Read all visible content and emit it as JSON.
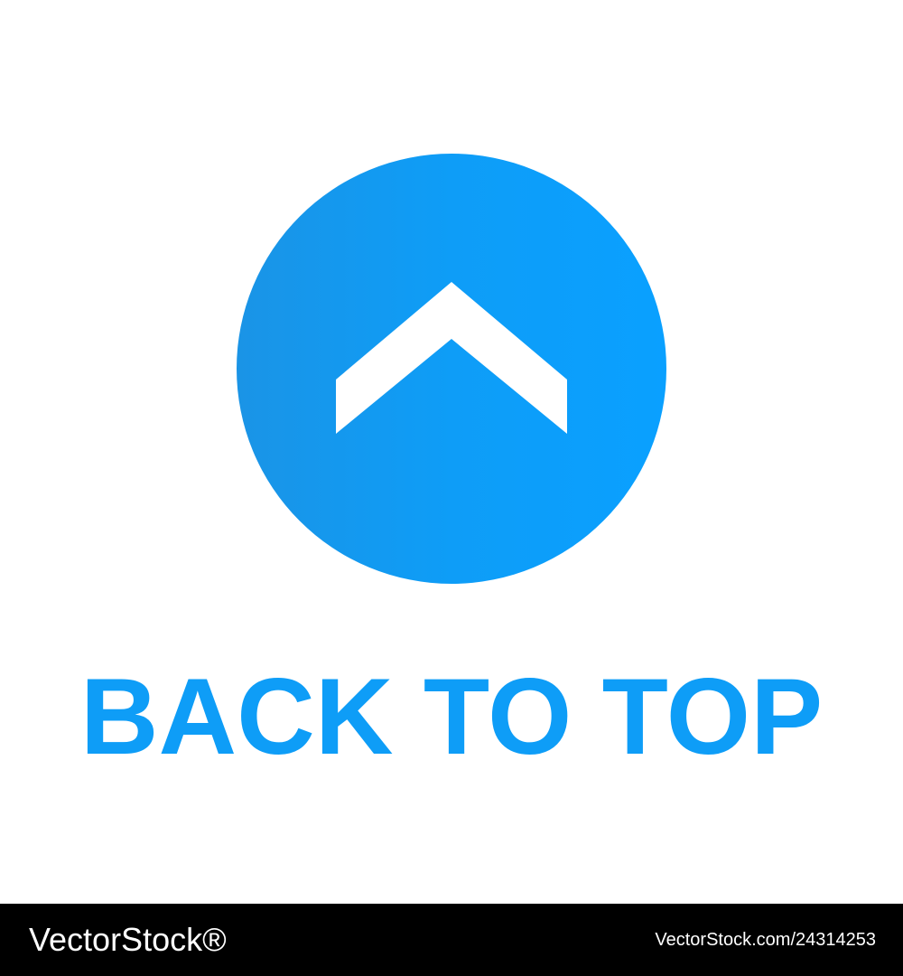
{
  "caption": "BACK TO TOP",
  "icon": "chevron-up-icon",
  "colors": {
    "button": "#0e9df7",
    "icon": "#ffffff",
    "caption": "#0e9df7",
    "footer_bg": "#000000",
    "footer_text": "#ffffff"
  },
  "footer": {
    "logo": "VectorStock®",
    "id": "VectorStock.com/24314253"
  }
}
